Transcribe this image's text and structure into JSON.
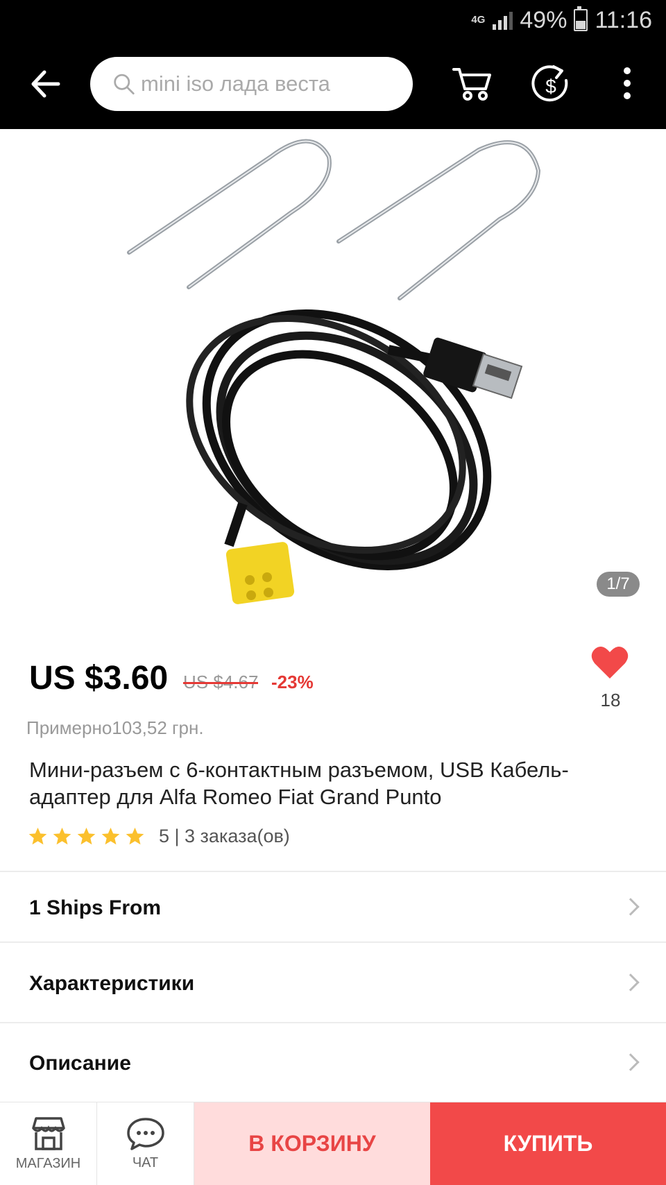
{
  "status_bar": {
    "network": "4G",
    "battery": "49%",
    "time": "11:16"
  },
  "toolbar": {
    "search_placeholder": "mini iso лада веста",
    "icons": [
      "back-arrow-icon",
      "search-icon",
      "cart-icon",
      "coin-dollar-icon",
      "more-vert-icon"
    ]
  },
  "gallery": {
    "counter": "1/7"
  },
  "product": {
    "price": "US $3.60",
    "old_price": "US $4.67",
    "discount": "-23%",
    "approx_price": "Примерно103,52 грн.",
    "title": "Мини-разъем с 6-контактным разъемом, USB Кабель-адаптер для Alfa Romeo Fiat Grand Punto",
    "rating_stars": 5,
    "rating_text": "5 | 3 заказа(ов)",
    "favorites_count": "18"
  },
  "rows": [
    {
      "label": "1 Ships From"
    },
    {
      "label": "Характеристики"
    },
    {
      "label": "Описание"
    }
  ],
  "bottom_bar": {
    "store_label": "МАГАЗИН",
    "chat_label": "ЧАТ",
    "cart_label": "В КОРЗИНУ",
    "buy_label": "КУПИТЬ"
  },
  "colors": {
    "accent": "#f24949",
    "accent_light": "#ffdcdc",
    "star": "#fbc02d"
  }
}
